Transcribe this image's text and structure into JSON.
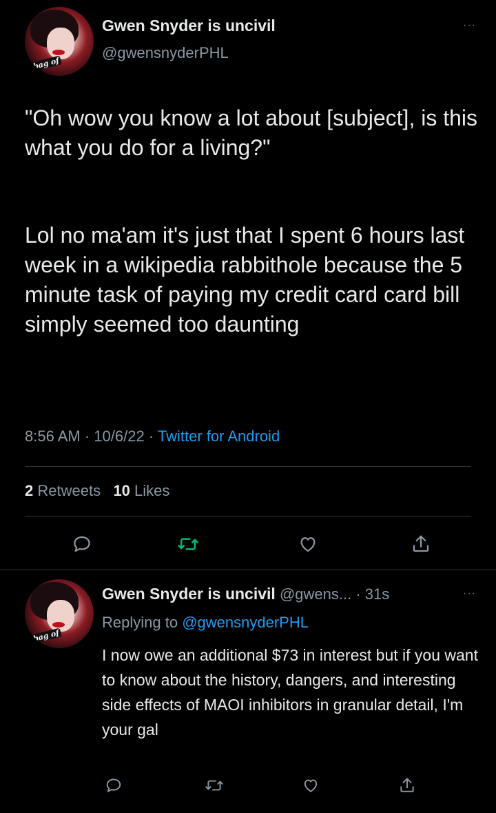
{
  "tweet": {
    "author_name": "Gwen Snyder is uncivil",
    "author_handle": "@gwensnyderPHL",
    "avatar_tag": "a bag of",
    "paragraph1": "\"Oh wow you know a lot about [subject], is this what you do for a living?\"",
    "paragraph2": "Lol no ma'am it's just that I spent 6 hours last week in a wikipedia rabbithole because the 5 minute task of paying my credit card card bill simply seemed too daunting",
    "time": "8:56 AM",
    "date": "10/6/22",
    "separator": "·",
    "source": "Twitter for Android",
    "retweets_count": "2",
    "retweets_label": "Retweets",
    "likes_count": "10",
    "likes_label": "Likes",
    "more_glyph": "···"
  },
  "reply": {
    "author_name": "Gwen Snyder is uncivil",
    "handle_truncated": "@gwens...",
    "separator": "·",
    "age": "31s",
    "replying_to_label": "Replying to",
    "replying_to_handle": "@gwensnyderPHL",
    "avatar_tag": "a bag of",
    "text": "I now owe an additional $73 in interest but if you want to know about the history, dangers, and interesting side effects of MAOI inhibitors in granular detail, I'm your gal",
    "more_glyph": "···"
  },
  "colors": {
    "background": "#000000",
    "text": "#e7e9ea",
    "muted": "#8b98a5",
    "link": "#1d9bf0",
    "retweet_active": "#00ba7c",
    "divider": "#2f3336"
  },
  "icons": [
    "reply-icon",
    "retweet-icon",
    "like-icon",
    "share-icon",
    "more-icon"
  ]
}
